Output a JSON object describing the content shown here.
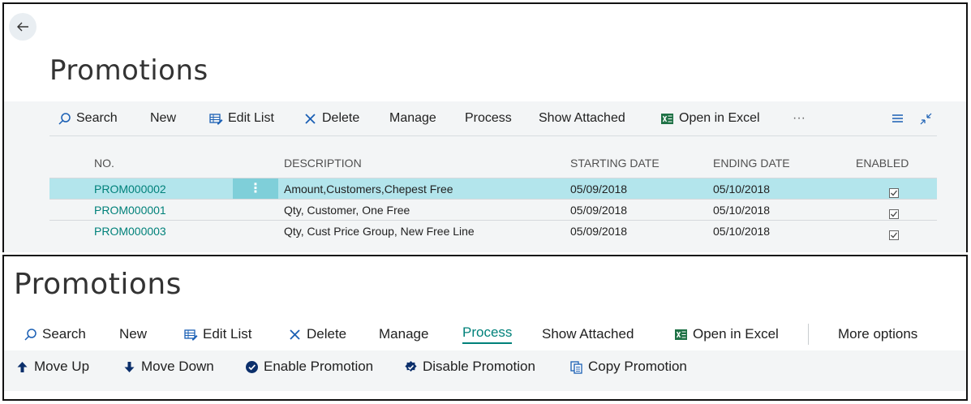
{
  "page_title": "Promotions",
  "toolbar": {
    "search": "Search",
    "new": "New",
    "edit_list": "Edit List",
    "delete": "Delete",
    "manage": "Manage",
    "process": "Process",
    "show_attached": "Show Attached",
    "open_in_excel": "Open in Excel",
    "more": "···",
    "more_options": "More options"
  },
  "grid": {
    "columns": {
      "no": "NO.",
      "description": "DESCRIPTION",
      "starting_date": "STARTING DATE",
      "ending_date": "ENDING DATE",
      "enabled": "ENABLED"
    },
    "rows": [
      {
        "no": "PROM000002",
        "description": "Amount,Customers,Chepest Free",
        "starting_date": "05/09/2018",
        "ending_date": "05/10/2018",
        "enabled": true
      },
      {
        "no": "PROM000001",
        "description": "Qty, Customer, One Free",
        "starting_date": "05/09/2018",
        "ending_date": "05/10/2018",
        "enabled": true
      },
      {
        "no": "PROM000003",
        "description": "Qty, Cust Price Group, New Free Line",
        "starting_date": "05/09/2018",
        "ending_date": "05/10/2018",
        "enabled": true
      }
    ]
  },
  "process_actions": {
    "move_up": "Move Up",
    "move_down": "Move Down",
    "enable_promotion": "Enable Promotion",
    "disable_promotion": "Disable Promotion",
    "copy_promotion": "Copy Promotion"
  },
  "colors": {
    "accent": "#00817a",
    "selected_row": "#b3e5ec",
    "excel_green": "#1e7145"
  }
}
